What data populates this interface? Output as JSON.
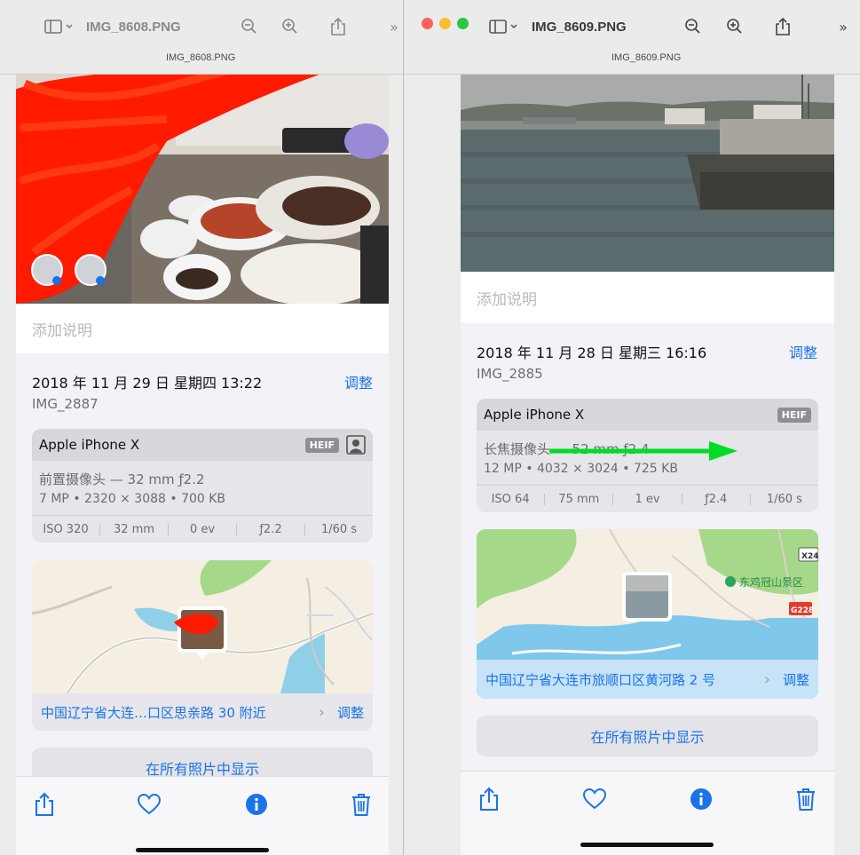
{
  "left_window": {
    "title": "IMG_8608.PNG",
    "subtitle": "IMG_8608.PNG",
    "info": {
      "caption_placeholder": "添加说明",
      "datetime": "2018 年 11 月 29 日  星期四 13:22",
      "adjust_label": "调整",
      "filename": "IMG_2887",
      "camera_model": "Apple iPhone X",
      "format_badge": "HEIF",
      "lens": "前置摄像头 — 32 mm ƒ2.2",
      "specs": "7 MP  •  2320 × 3088  •  700 KB",
      "exif": [
        "ISO 320",
        "32 mm",
        "0 ev",
        "ƒ2.2",
        "1/60 s"
      ],
      "address": "中国辽宁省大连…口区思亲路 30 附近",
      "address_adjust": "调整",
      "show_all": "在所有照片中显示"
    }
  },
  "right_window": {
    "title": "IMG_8609.PNG",
    "subtitle": "IMG_8609.PNG",
    "info": {
      "caption_placeholder": "添加说明",
      "datetime": "2018 年 11 月 28 日  星期三 16:16",
      "adjust_label": "调整",
      "filename": "IMG_2885",
      "camera_model": "Apple iPhone X",
      "format_badge": "HEIF",
      "lens": "长焦摄像头 — 52 mm ƒ2.4",
      "specs": "12 MP  •  4032 × 3024  •  725 KB",
      "exif": [
        "ISO 64",
        "75 mm",
        "1 ev",
        "ƒ2.4",
        "1/60 s"
      ],
      "map_poi": "东鸡冠山景区",
      "road_badge_1": "X24",
      "road_badge_2": "G228",
      "address": "中国辽宁省大连市旅顺口区黄河路 2 号",
      "address_adjust": "调整",
      "show_all": "在所有照片中显示"
    }
  },
  "colors": {
    "accent": "#1a73e8",
    "traffic_red": "#fe5f57",
    "traffic_yellow": "#febc2e",
    "traffic_green": "#28c840",
    "annotation_arrow": "#00dd22",
    "scribble": "#ff1a00"
  }
}
